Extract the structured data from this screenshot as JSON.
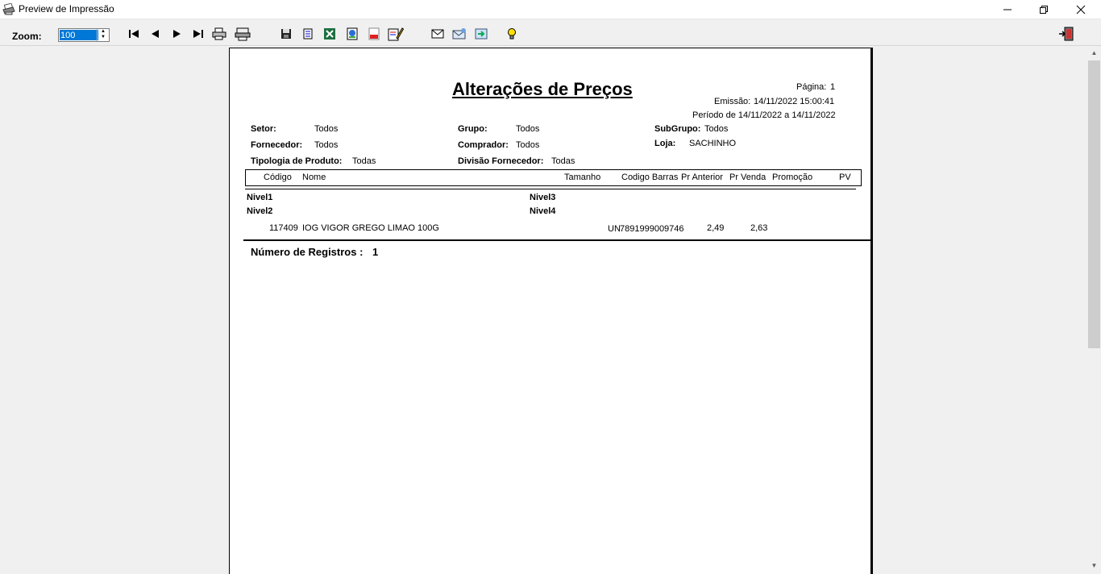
{
  "window": {
    "title": "Preview de Impressão",
    "icons": [
      "printer-icon",
      "minimize-icon",
      "restore-icon",
      "close-icon"
    ]
  },
  "toolbar": {
    "zoom_label": "Zoom:",
    "zoom_value": "100",
    "buttons": [
      "first-page",
      "previous-page",
      "next-page",
      "last-page",
      "print",
      "page-setup",
      "save",
      "export-text",
      "export-excel",
      "export-html",
      "export-pdf",
      "design",
      "send-email",
      "send-outlook",
      "export-file",
      "tips",
      "exit"
    ]
  },
  "report": {
    "title": "Alterações de Preços",
    "page_label": "Página:",
    "page_value": "1",
    "emission_label": "Emissão:",
    "emission_value": "14/11/2022 15:00:41",
    "period": "Período de 14/11/2022 a 14/11/2022",
    "filters": {
      "setor_label": "Setor:",
      "setor_value": "Todos",
      "grupo_label": "Grupo:",
      "grupo_value": "Todos",
      "subgrupo_label": "SubGrupo:",
      "subgrupo_value": "Todos",
      "fornecedor_label": "Fornecedor:",
      "fornecedor_value": "Todos",
      "comprador_label": "Comprador:",
      "comprador_value": "Todos",
      "loja_label": "Loja:",
      "loja_value": "SACHINHO",
      "tipologia_label": "Tipologia de Produto:",
      "tipologia_value": "Todas",
      "divisao_label": "Divisão Fornecedor:",
      "divisao_value": "Todas"
    },
    "columns": [
      "Código",
      "Nome",
      "Tamanho",
      "Codigo Barras",
      "Pr Anterior",
      "Pr Venda",
      "Promoção",
      "PV"
    ],
    "levels": [
      "Nivel1",
      "Nivel2",
      "Nivel3",
      "Nivel4"
    ],
    "rows": [
      {
        "codigo": "117409",
        "nome": "IOG VIGOR GREGO LIMAO 100G",
        "tamanho": "UN",
        "codigo_barras": "7891999009746",
        "pr_anterior": "2,49",
        "pr_venda": "2,63",
        "promocao": "",
        "pv": ""
      }
    ],
    "records_label": "Número de Registros :",
    "records_value": "1"
  }
}
